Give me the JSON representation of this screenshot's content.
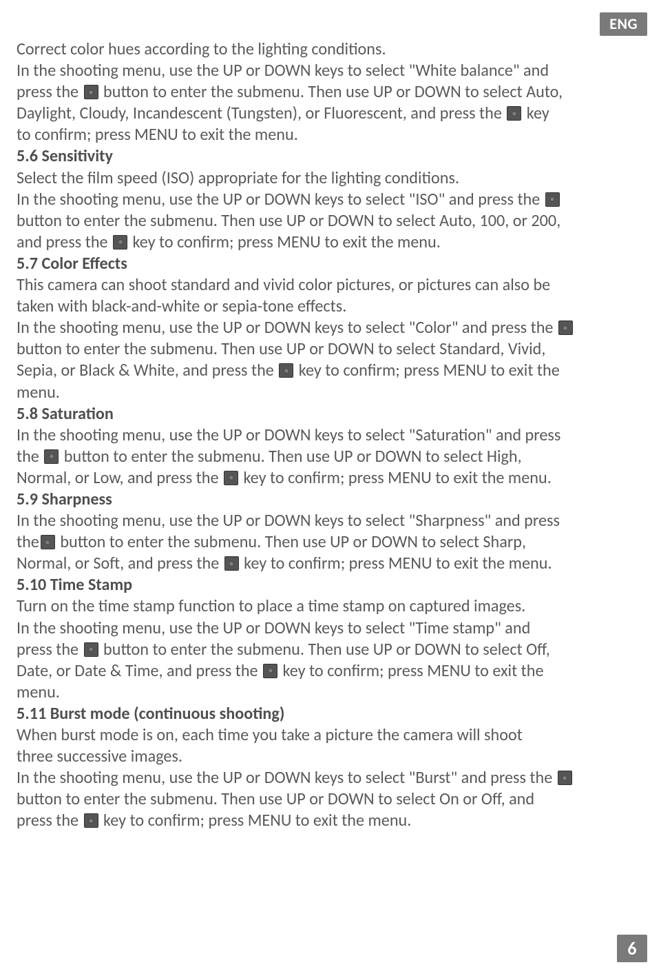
{
  "lang_badge": "ENG",
  "page_number": "6",
  "intro": {
    "l1": "Correct color hues according to the lighting conditions.",
    "l2a": "In the shooting menu, use the UP or DOWN keys to select \"White balance\" and",
    "l2b": "press the ",
    "l2c": " button to enter the submenu. Then use UP or DOWN to select Auto,",
    "l3a": "Daylight, Cloudy, Incandescent (Tungsten), or Fluorescent, and press the ",
    "l3b": " key",
    "l4": "to confirm; press MENU to exit the menu."
  },
  "s56": {
    "title": "5.6 Sensitivity",
    "l1": "Select the film speed (ISO) appropriate for the lighting conditions.",
    "l2a": "In the shooting menu, use the UP or DOWN keys to select \"ISO\" and press the ",
    "l3": "button to enter the submenu. Then use UP or DOWN to select Auto, 100, or 200,",
    "l4a": "and press the ",
    "l4b": " key to confirm; press MENU to exit the menu."
  },
  "s57": {
    "title": "5.7 Color Effects",
    "l1": "This camera can shoot standard and vivid color pictures, or pictures can also be",
    "l2": "taken with black-and-white or sepia-tone effects.",
    "l3a": "In the shooting menu, use the UP or DOWN keys to select \"Color\" and press the ",
    "l4": "button to enter the submenu. Then use UP or DOWN to select Standard, Vivid,",
    "l5a": "Sepia, or Black & White, and press the ",
    "l5b": " key to confirm; press MENU to exit the",
    "l6": "menu."
  },
  "s58": {
    "title": "5.8 Saturation",
    "l1": "In the shooting menu, use the UP or DOWN keys to select \"Saturation\" and press",
    "l2a": "the ",
    "l2b": " button to enter the submenu. Then use UP or DOWN to select High,",
    "l3a": "Normal, or Low, and press the ",
    "l3b": " key to confirm; press MENU to exit the menu."
  },
  "s59": {
    "title": "5.9 Sharpness",
    "l1": "In the shooting menu, use the UP or DOWN keys to select \"Sharpness\" and press",
    "l2a": "the",
    "l2b": " button to enter the submenu. Then use UP or DOWN to select Sharp,",
    "l3a": "Normal, or Soft, and press the ",
    "l3b": " key to confirm; press MENU to exit the menu."
  },
  "s510": {
    "title": "5.10 Time Stamp",
    "l1": "Turn on the time stamp function to place a time stamp on captured images.",
    "l2": "In the shooting menu, use the UP or DOWN keys to select \"Time stamp\" and",
    "l3a": "press the ",
    "l3b": " button to enter the submenu. Then use UP or DOWN to select Off,",
    "l4a": "Date, or Date & Time, and press the ",
    "l4b": " key to confirm; press MENU to exit the",
    "l5": "menu."
  },
  "s511": {
    "title": "5.11 Burst mode (continuous shooting)",
    "l1": "When burst mode is on, each time you take a picture the camera will shoot",
    "l2": "three successive images.",
    "l3a": "In the shooting menu, use the UP or DOWN keys to select \"Burst\" and press the ",
    "l4": "button to enter the submenu. Then use UP or DOWN to select On or Off, and",
    "l5a": "press the ",
    "l5b": " key to confirm; press MENU to exit the menu."
  }
}
